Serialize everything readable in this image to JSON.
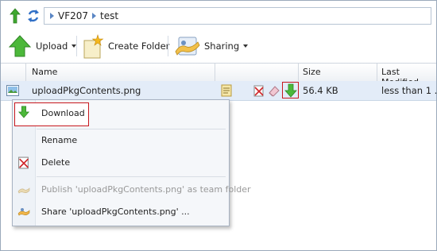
{
  "breadcrumb": {
    "segments": [
      "VF207",
      "test"
    ]
  },
  "toolbar": {
    "upload_label": "Upload",
    "create_folder_label": "Create Folder",
    "sharing_label": "Sharing"
  },
  "grid": {
    "columns": {
      "name": "Name",
      "size": "Size",
      "last_modified": "Last Modified"
    },
    "rows": [
      {
        "name": "uploadPkgContents.png",
        "size": "56.4 KB",
        "last_modified": "less than 1 ..."
      }
    ]
  },
  "context_menu": {
    "items": [
      {
        "label": "Download",
        "icon": "download-arrow-icon",
        "enabled": true
      },
      {
        "label": "Rename",
        "icon": "",
        "enabled": true
      },
      {
        "label": "Delete",
        "icon": "delete-icon",
        "enabled": true
      },
      {
        "label": "Publish 'uploadPkgContents.png' as team folder",
        "icon": "publish-icon",
        "enabled": false
      },
      {
        "label": "Share 'uploadPkgContents.png' ...",
        "icon": "share-icon",
        "enabled": true
      }
    ]
  },
  "colors": {
    "highlight_border": "#c8181e",
    "selection_bg": "#e3ecf8",
    "accent_green": "#3fa82f",
    "accent_blue": "#5a86c4"
  }
}
